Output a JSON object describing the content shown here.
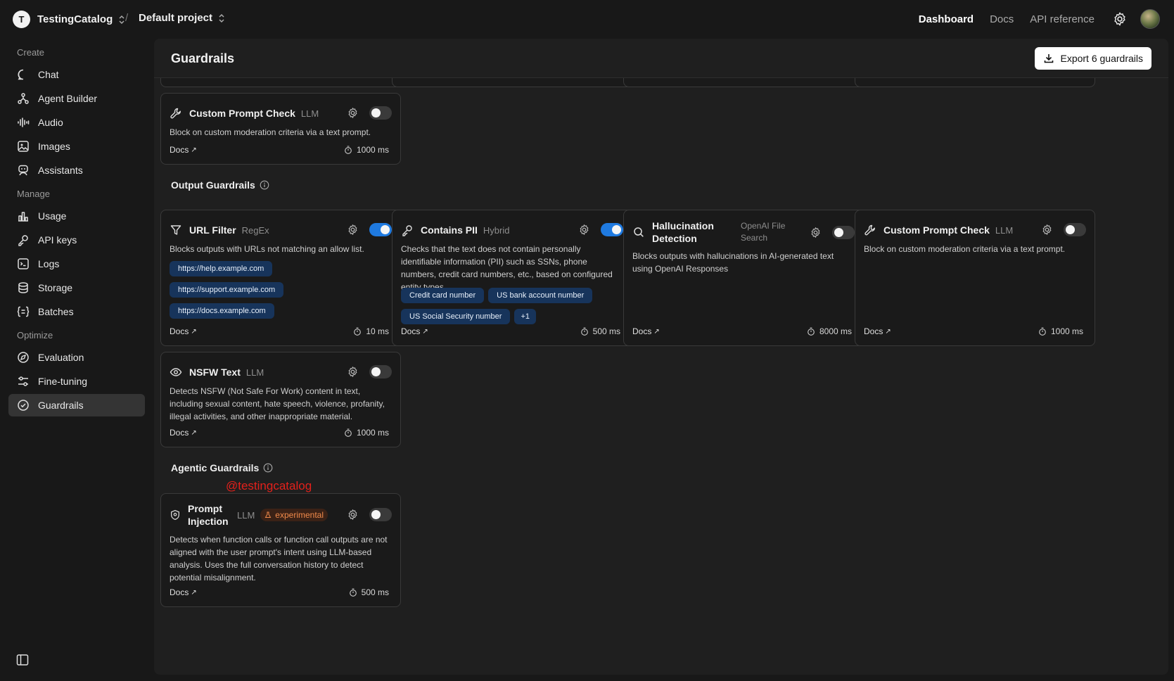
{
  "topbar": {
    "org_initial": "T",
    "org_name": "TestingCatalog",
    "separator": "/",
    "project": "Default project",
    "nav": [
      "Dashboard",
      "Docs",
      "API reference"
    ]
  },
  "sidebar": {
    "sections": [
      {
        "title": "Create",
        "items": [
          "Chat",
          "Agent Builder",
          "Audio",
          "Images",
          "Assistants"
        ]
      },
      {
        "title": "Manage",
        "items": [
          "Usage",
          "API keys",
          "Logs",
          "Storage",
          "Batches"
        ]
      },
      {
        "title": "Optimize",
        "items": [
          "Evaluation",
          "Fine-tuning",
          "Guardrails"
        ]
      }
    ]
  },
  "page": {
    "title": "Guardrails",
    "export_label": "Export 6 guardrails"
  },
  "common": {
    "docs": "Docs"
  },
  "cards": {
    "top_custom": {
      "title": "Custom Prompt Check",
      "type": "LLM",
      "desc": "Block on custom moderation criteria via a text prompt.",
      "latency": "1000 ms",
      "enabled": false
    },
    "url_filter": {
      "title": "URL Filter",
      "type": "RegEx",
      "desc": "Blocks outputs with URLs not matching an allow list.",
      "chips": [
        "https://help.example.com",
        "https://support.example.com",
        "https://docs.example.com"
      ],
      "latency": "10 ms",
      "enabled": true
    },
    "contains_pii": {
      "title": "Contains PII",
      "type": "Hybrid",
      "desc": "Checks that the text does not contain personally identifiable information (PII) such as SSNs, phone numbers, credit card numbers, etc., based on configured entity types.",
      "chips": [
        "Credit card number",
        "US bank account number",
        "US Social Security number",
        "+1"
      ],
      "latency": "500 ms",
      "enabled": true
    },
    "hallucination": {
      "title": "Hallucination Detection",
      "type": "OpenAI File Search",
      "desc": "Blocks outputs with hallucinations in AI-generated text using OpenAI Responses",
      "latency": "8000 ms",
      "enabled": false
    },
    "output_custom": {
      "title": "Custom Prompt Check",
      "type": "LLM",
      "desc": "Block on custom moderation criteria via a text prompt.",
      "latency": "1000 ms",
      "enabled": false
    },
    "nsfw": {
      "title": "NSFW Text",
      "type": "LLM",
      "desc": "Detects NSFW (Not Safe For Work) content in text, including sexual content, hate speech, violence, profanity, illegal activities, and other inappropriate material.",
      "latency": "1000 ms",
      "enabled": false
    },
    "prompt_injection": {
      "title": "Prompt Injection",
      "type": "LLM",
      "badge": "experimental",
      "desc": "Detects when function calls or function call outputs are not aligned with the user prompt's intent using LLM-based analysis. Uses the full conversation history to detect potential misalignment.",
      "latency": "500 ms",
      "enabled": false
    }
  },
  "sections": {
    "output": "Output Guardrails",
    "agentic": "Agentic Guardrails"
  },
  "watermark": "@testingcatalog",
  "colors": {
    "accent": "#1f7ae0",
    "chip_bg": "#17345b",
    "experimental": "#f08a4b",
    "watermark": "#e3201b"
  }
}
